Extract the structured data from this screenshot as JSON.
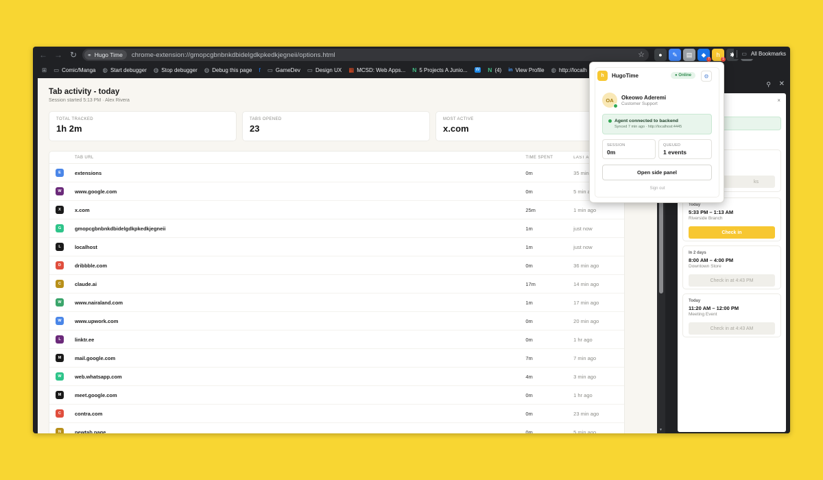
{
  "browser": {
    "nav": {
      "back": "←",
      "forward": "→",
      "reload": "↻"
    },
    "site_chip": "Hugo Time",
    "url": "chrome-extension://gmopcgbnbnkdbidelgdkpkedkjegneii/options.html",
    "star": "☆",
    "extensions": [
      {
        "name": "ext-dark",
        "color": "#3c4043",
        "glyph": "●",
        "badge": ""
      },
      {
        "name": "ext-blue-pen",
        "color": "#4285f4",
        "glyph": "✎",
        "badge": ""
      },
      {
        "name": "ext-gray-doc",
        "color": "#9aa0a6",
        "glyph": "▤",
        "badge": ""
      },
      {
        "name": "ext-blue-bug",
        "color": "#1a73e8",
        "glyph": "◆",
        "badge": "7"
      },
      {
        "name": "ext-hugotime",
        "color": "#f7c731",
        "glyph": "h",
        "badge": "1"
      },
      {
        "name": "ext-puzzle",
        "color": "#3c4043",
        "glyph": "✱",
        "badge": ""
      },
      {
        "name": "ext-sidepanel",
        "color": "#5f6368",
        "glyph": "▥",
        "badge": ""
      }
    ],
    "profile_glyph": "⌇",
    "menu_glyph": "⋮",
    "bookmarks": [
      {
        "icon": "folder",
        "glyph": "▭",
        "label": "Comic/Manga"
      },
      {
        "icon": "globe",
        "glyph": "◍",
        "label": "Start debugger"
      },
      {
        "icon": "globe",
        "glyph": "◍",
        "label": "Stop debugger"
      },
      {
        "icon": "globe",
        "glyph": "◍",
        "label": "Debug this page"
      },
      {
        "icon": "facebook",
        "glyph": "f",
        "label": ""
      },
      {
        "icon": "folder",
        "glyph": "▭",
        "label": "GameDev"
      },
      {
        "icon": "folder",
        "glyph": "▭",
        "label": "Design UX"
      },
      {
        "icon": "microsoft",
        "glyph": "▦",
        "label": "MCSD: Web Apps..."
      },
      {
        "icon": "nuxt",
        "glyph": "N",
        "label": "5 Projects A Junio..."
      },
      {
        "icon": "wordpress",
        "glyph": "W",
        "label": ""
      },
      {
        "icon": "nuxt",
        "glyph": "N",
        "label": "(4)"
      },
      {
        "icon": "linkedin",
        "glyph": "in",
        "label": "View Profile"
      },
      {
        "icon": "globe",
        "glyph": "◍",
        "label": "http://localh"
      }
    ],
    "all_bookmarks": "All Bookmarks"
  },
  "page": {
    "title": "Tab activity - today",
    "subtitle": "Session started 5:13 PM · Alex Rivera",
    "cards": [
      {
        "label": "TOTAL TRACKED",
        "value": "1h 2m"
      },
      {
        "label": "TABS OPENED",
        "value": "23"
      },
      {
        "label": "MOST ACTIVE",
        "value": "x.com"
      }
    ],
    "table": {
      "headers": {
        "url": "TAB URL",
        "time": "TIME SPENT",
        "last": "LAST A"
      },
      "rows": [
        {
          "letter": "E",
          "color": "#4a86e8",
          "url": "extensions",
          "time": "0m",
          "last": "35 min ago"
        },
        {
          "letter": "W",
          "color": "#6b2a7a",
          "url": "www.google.com",
          "time": "0m",
          "last": "5 min ago"
        },
        {
          "letter": "X",
          "color": "#1a1a1a",
          "url": "x.com",
          "time": "25m",
          "last": "1 min ago"
        },
        {
          "letter": "G",
          "color": "#2ec48a",
          "url": "gmopcgbnbnkdbidelgdkpkedkjegneii",
          "time": "1m",
          "last": "just now"
        },
        {
          "letter": "L",
          "color": "#1a1a1a",
          "url": "localhost",
          "time": "1m",
          "last": "just now"
        },
        {
          "letter": "D",
          "color": "#e04e3d",
          "url": "dribbble.com",
          "time": "0m",
          "last": "36 min ago"
        },
        {
          "letter": "C",
          "color": "#b8901a",
          "url": "claude.ai",
          "time": "17m",
          "last": "14 min ago"
        },
        {
          "letter": "W",
          "color": "#3aa56b",
          "url": "www.nairaland.com",
          "time": "1m",
          "last": "17 min ago"
        },
        {
          "letter": "W",
          "color": "#4a86e8",
          "url": "www.upwork.com",
          "time": "0m",
          "last": "20 min ago"
        },
        {
          "letter": "L",
          "color": "#6b2a7a",
          "url": "linktr.ee",
          "time": "0m",
          "last": "1 hr ago"
        },
        {
          "letter": "M",
          "color": "#1a1a1a",
          "url": "mail.google.com",
          "time": "7m",
          "last": "7 min ago"
        },
        {
          "letter": "W",
          "color": "#2ec48a",
          "url": "web.whatsapp.com",
          "time": "4m",
          "last": "3 min ago"
        },
        {
          "letter": "M",
          "color": "#1a1a1a",
          "url": "meet.google.com",
          "time": "0m",
          "last": "1 hr ago"
        },
        {
          "letter": "C",
          "color": "#e04e3d",
          "url": "contra.com",
          "time": "0m",
          "last": "23 min ago"
        },
        {
          "letter": "N",
          "color": "#b8901a",
          "url": "newtab.page",
          "time": "0m",
          "last": "5 min ago"
        }
      ]
    }
  },
  "side_panel": {
    "pin_glyph": "⚲",
    "close_glyph": "✕",
    "inner_close": "×",
    "shifts": [
      {
        "day": "Today",
        "time": "5:33 PM – 1:13 AM",
        "place": "Riverside Branch",
        "action": "Check in",
        "style": "yellow"
      },
      {
        "day": "In 2 days",
        "time": "8:00 AM – 4:00 PM",
        "place": "Downtown Store",
        "action": "Check in at 4:43 PM",
        "style": "gray"
      },
      {
        "day": "Today",
        "time": "11:20 AM – 12:00 PM",
        "place": "Meeting Event",
        "action": "Check in at 4:43 AM",
        "style": "gray"
      }
    ],
    "partial_button": "ks"
  },
  "popup": {
    "logo": "h",
    "brand": "HugoTime",
    "status": "● Online",
    "gear": "⚙",
    "user": {
      "initials": "OA",
      "name": "Okeowo Aderemi",
      "role": "Customer Support"
    },
    "agent_title": "Agent connected to backend",
    "agent_sub": "Synced 7 min ago · http://localhost:4445",
    "session_label": "SESSION",
    "session_value": "0m",
    "queued_label": "QUEUED",
    "queued_value": "1 events",
    "open_button": "Open side panel",
    "sign_out": "Sign out"
  }
}
